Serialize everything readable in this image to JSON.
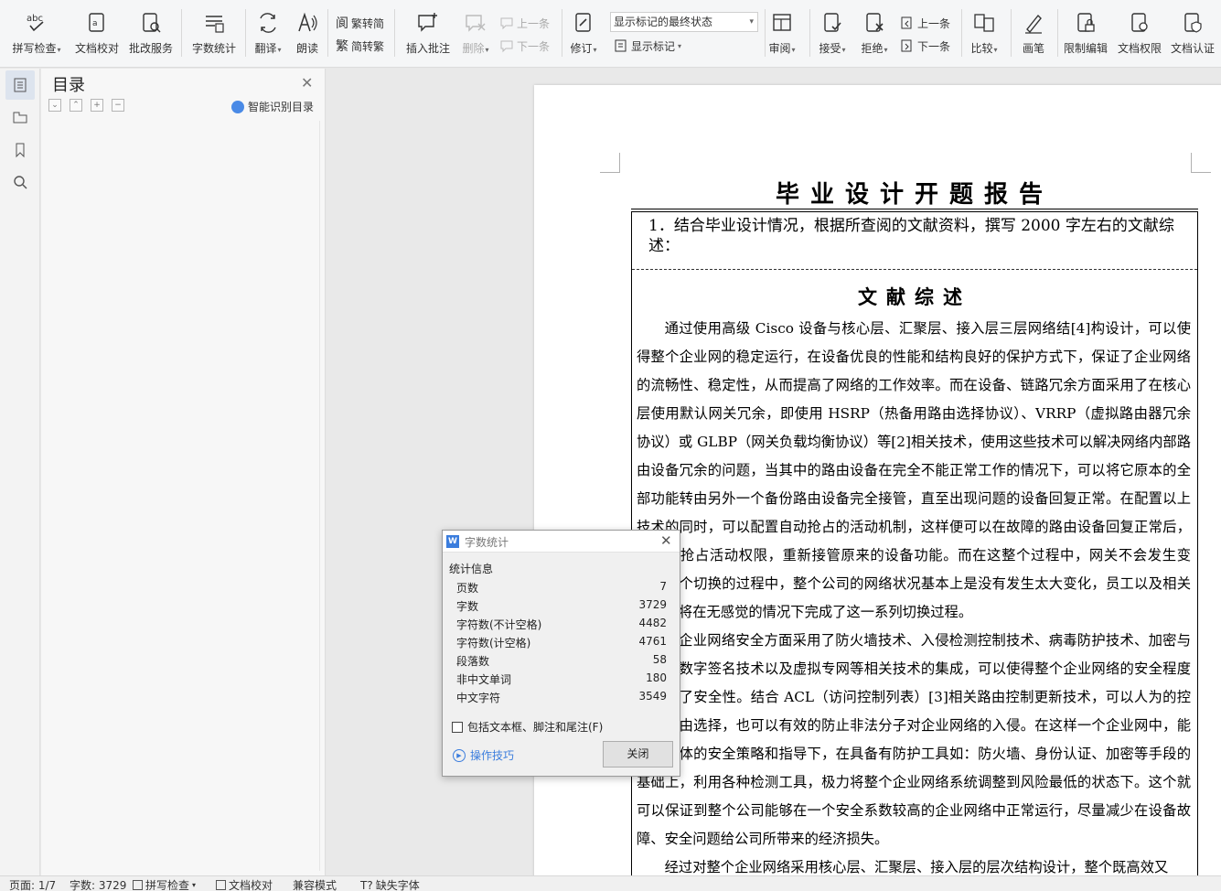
{
  "ribbon": {
    "spell_check": "拼写检查",
    "doc_proof": "文档校对",
    "correction_service": "批改服务",
    "word_count": "字数统计",
    "translate": "翻译",
    "read_aloud": "朗读",
    "trad_to_simp": "繁转简",
    "simp_to_trad": "简转繁",
    "insert_comment": "插入批注",
    "delete": "删除",
    "prev_comment": "上一条",
    "next_comment": "下一条",
    "track_changes": "修订",
    "markup_mode": "显示标记的最终状态",
    "show_markup": "显示标记",
    "review": "审阅",
    "accept": "接受",
    "reject": "拒绝",
    "prev_change": "上一条",
    "next_change": "下一条",
    "compare": "比较",
    "ink": "画笔",
    "restrict_edit": "限制编辑",
    "doc_permission": "文档权限",
    "doc_cert": "文档认证"
  },
  "toc": {
    "title": "目录",
    "smart_detect": "智能识别目录"
  },
  "document": {
    "title": "毕业设计开题报告",
    "prompt": "1．结合毕业设计情况，根据所查阅的文献资料，撰写 2000 字左右的文献综述：",
    "section_title": "文献综述",
    "paragraph1": "通过使用高级 Cisco 设备与核心层、汇聚层、接入层三层网络结[4]构设计，可以使得整个企业网的稳定运行，在设备优良的性能和结构良好的保护方式下，保证了企业网络的流畅性、稳定性，从而提高了网络的工作效率。而在设备、链路冗余方面采用了在核心层使用默认网关冗余，即使用 HSRP（热备用路由选择协议）、VRRP（虚拟路由器冗余协议）或 GLBP（网关负载均衡协议）等[2]相关技术，使用这些技术可以解决网络内部路由设备冗余的问题，当其中的路由设备在完全不能正常工作的情况下，可以将它原本的全部功能转由另外一个备份路由设备完全接管，直至出现问题的设备回复正常。在配置以上技术的同时，可以配置自动抢占的活动机制，这样便可以在故障的路由设备回复正常后，会自动抢占活动权限，重新接管原来的设备功能。而在这整个过程中，网关不会发生变化，整个切换的过程中，整个公司的网络状况基本上是没有发生太大变化，员工以及相关用户也将在无感觉的情况下完成了这一系列切换过程。",
    "paragraph2": "在企业网络安全方面采用了防火墙技术、入侵检测控制技术、病毒防护技术、加密与认证和数字签名技术以及虚拟专网等相关技术的集成，可以使得整个企业网络的安全程度上提高了安全性。结合 ACL（访问控制列表）[3]相关路由控制更新技术，可以人为的控制好路由选择，也可以有效的防止非法分子对企业网络的入侵。在这样一个企业网中，能够在整体的安全策略和指导下，在具备有防护工具如：防火墙、身份认证、加密等手段的基础上，利用各种检测工具，极力将整个企业网络系统调整到风险最低的状态下。这个就可以保证到整个公司能够在一个安全系数较高的企业网络中正常运行，尽量减少在设备故障、安全问题给公司所带来的经济损失。",
    "paragraph3": "经过对整个企业网络采用核心层、汇聚层、接入层的层次结构设计，整个既高效又"
  },
  "dialog": {
    "title": "字数统计",
    "section": "统计信息",
    "rows": [
      {
        "label": "页数",
        "value": "7"
      },
      {
        "label": "字数",
        "value": "3729"
      },
      {
        "label": "字符数(不计空格)",
        "value": "4482"
      },
      {
        "label": "字符数(计空格)",
        "value": "4761"
      },
      {
        "label": "段落数",
        "value": "58"
      },
      {
        "label": "非中文单词",
        "value": "180"
      },
      {
        "label": "中文字符",
        "value": "3549"
      }
    ],
    "include_label": "包括文本框、脚注和尾注(F)",
    "include_checked": false,
    "tips": "操作技巧",
    "close_button": "关闭"
  },
  "status": {
    "page": "页面: 1/7",
    "words": "字数: 3729",
    "spell": "拼写检查",
    "proof": "文档校对",
    "compat": "兼容模式",
    "missing_font": "缺失字体"
  },
  "colors": {
    "accent": "#3b7ddd",
    "ribbon_bg": "#f5f6f7",
    "workspace_bg": "#e9e9e9"
  }
}
